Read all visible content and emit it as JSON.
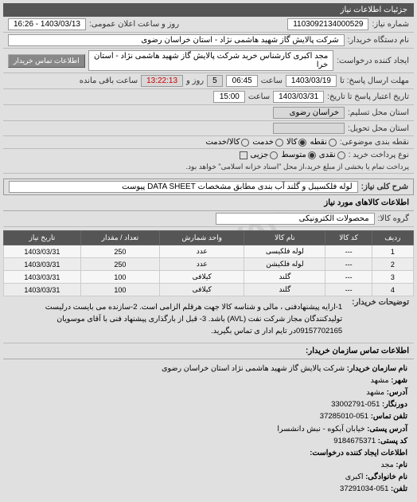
{
  "header": {
    "right": "جزئیات اطلاعات نیاز"
  },
  "watermark": "۰۹۴۳۹۶۷۵۲۰",
  "fields": {
    "req_no_label": "شماره نیاز:",
    "req_no": "1103092134000529",
    "announce_label": "روز و ساعت اعلان عمومی:",
    "announce": "1403/03/13 - 16:26",
    "buyer_org_label": "نام دستگاه خریدار:",
    "buyer_org": "شرکت پالایش گاز شهید هاشمی نژاد - استان خراسان رضوی",
    "creator_label": "ایجاد کننده درخواست:",
    "creator": "مجد اکبری کارشناس خرید شرکت پالایش گاز شهید هاشمی نژاد - استان خرا",
    "contact_btn": "اطلاعات تماس خریدار",
    "deadline_label": "مهلت ارسال پاسخ: تا",
    "deadline_date": "1403/03/19",
    "deadline_sat": "ساعت",
    "deadline_time": "06:45",
    "remain_label": "روز و",
    "remain_days": "5",
    "remain_time": "13:22:13",
    "remain_suffix": "ساعت باقی مانده",
    "valid_label": "تاریخ اعتبار پاسخ تا تاریخ:",
    "valid_date": "1403/03/31",
    "valid_sat": "ساعت",
    "valid_time": "15:00",
    "city_label": "استان محل تسلیم:",
    "city": "خراسان رضوی",
    "delivery_label": "استان محل تحویل:",
    "cod_label": "نقطه بندی موضوعی:",
    "cod_opts": [
      "نقطه",
      "کالا",
      "خدمت",
      "کالا/خدمت"
    ],
    "pay_label": "نوع پرداخت خرید :",
    "pay_opts": [
      "نقدی",
      "متوسط",
      "جزیی"
    ],
    "pay_note": "پرداخت تمام یا بخشی از مبلغ خرید،از محل \"اسناد خزانه اسلامی\" خواهد بود."
  },
  "desc": {
    "label": "شرح کلی نیاز:",
    "text": "لوله فلکسیبل و گلند آب بندی مطابق مشخصات DATA SHEET پیوست"
  },
  "goods": {
    "title": "اطلاعات کالاهای مورد نیاز",
    "group_label": "گروه کالا:",
    "group": "محصولات الکترونیکی"
  },
  "table": {
    "headers": [
      "ردیف",
      "کد کالا",
      "نام کالا",
      "واحد شمارش",
      "تعداد / مقدار",
      "تاریخ نیاز"
    ],
    "rows": [
      [
        "1",
        "---",
        "لوله فلکیسی",
        "عدد",
        "250",
        "1403/03/31"
      ],
      [
        "2",
        "---",
        "لوله فلکیشن",
        "عدد",
        "250",
        "1403/03/31"
      ],
      [
        "3",
        "---",
        "گلند",
        "کیلافی",
        "100",
        "1403/03/31"
      ],
      [
        "4",
        "---",
        "گلند",
        "کیلافی",
        "100",
        "1403/03/31"
      ]
    ]
  },
  "buyer_notes": {
    "label": "توضیحات خریدار:",
    "text": "1-ارایه پیشنهادفنی ، مالی و شناسه کالا جهت هرقلم الزامی است. 2-سازنده می بایست درلیست تولیدکنندگان مجاز شرکت نفت (AVL) باشد. 3- قبل از بارگذاری پیشنهاد فنی با آقای موسویان 09157702165در تایم ادار ی تماس بگیرید."
  },
  "contact": {
    "title": "اطلاعات تماس سازمان خریدار:",
    "org_label": "نام سازمان خریدار:",
    "org": "شرکت پالایش گاز شهید هاشمی نژاد استان خراسان رضوی",
    "city_label": "شهر:",
    "city": "مشهد",
    "addr_label": "آدرس:",
    "addr": "مشهد",
    "tel_label": "دورنگار:",
    "tel": "051-33002791",
    "fax_label": "تلفن تماس:",
    "fax": "051-37285010",
    "addr2_label": "آدرس پستی:",
    "addr2": "خیابان آبکوه - نبش دانشسرا",
    "post_label": "کد پستی:",
    "post": "9184675371",
    "creator_title": "اطلاعات ایجاد کننده درخواست:",
    "name_label": "نام:",
    "name": "مجد",
    "fam_label": "نام خانوادگی:",
    "fam": "اکبری",
    "phone_label": "تلفن:",
    "phone": "051-37291034"
  }
}
